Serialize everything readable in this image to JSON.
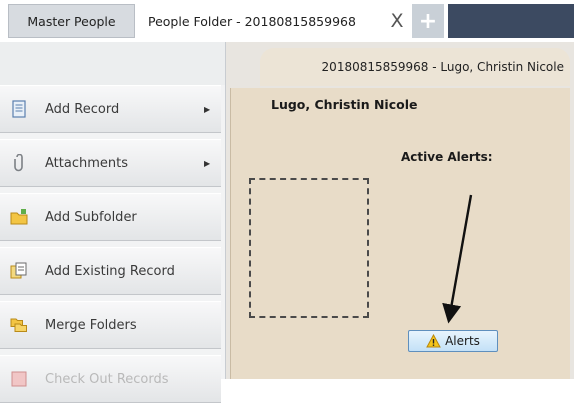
{
  "tabs": {
    "master_label": "Master People",
    "folder_label": "People Folder - 20180815859968",
    "close_glyph": "X",
    "new_glyph": "+"
  },
  "sidebar": {
    "items": [
      {
        "label": "Add Record",
        "icon": "document-icon",
        "has_submenu": true
      },
      {
        "label": "Attachments",
        "icon": "paperclip-icon",
        "has_submenu": true
      },
      {
        "label": "Add Subfolder",
        "icon": "folder-icon",
        "has_submenu": false
      },
      {
        "label": "Add Existing Record",
        "icon": "existing-record-icon",
        "has_submenu": false
      },
      {
        "label": "Merge Folders",
        "icon": "merge-folders-icon",
        "has_submenu": false
      },
      {
        "label": "Check Out Records",
        "icon": "check-out-icon",
        "has_submenu": false
      }
    ],
    "submenu_arrow": "▶"
  },
  "folder": {
    "header": "20180815859968 - Lugo, Christin Nicole",
    "person_name": "Lugo, Christin Nicole",
    "alerts_heading": "Active Alerts:",
    "alerts_button": "Alerts"
  },
  "colors": {
    "tab_strip_fill": "#3c4a61",
    "panel_background": "#e8dcc8",
    "alerts_button": "#c3e1f7"
  }
}
